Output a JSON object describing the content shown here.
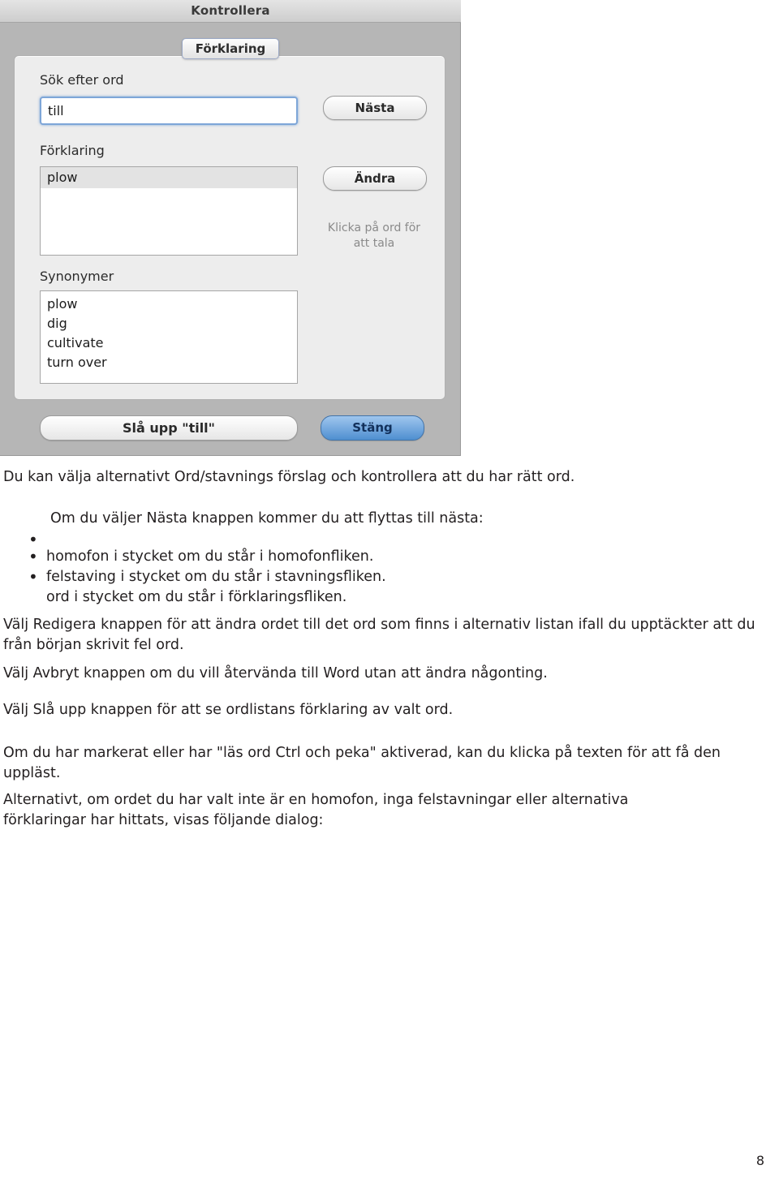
{
  "dialog": {
    "window_title": "Kontrollera",
    "tab_label": "Förklaring",
    "search_label": "Sök efter ord",
    "search_value": "till",
    "explanation_label": "Förklaring",
    "explanation_items": [
      "plow"
    ],
    "synonyms_label": "Synonymer",
    "synonyms": [
      "plow",
      "dig",
      "cultivate",
      "turn over"
    ],
    "next_button": "Nästa",
    "change_button": "Ändra",
    "speak_hint_line1": "Klicka på ord för",
    "speak_hint_line2": "att tala",
    "lookup_button": "Slå upp \"till\"",
    "close_button": "Stäng",
    "accent_color": "#4f8fd0"
  },
  "document": {
    "paragraphs": {
      "intro": "Du kan välja alternativt Ord/stavnings förslag och kontrollera att du har rätt ord.",
      "next_intro": "Om du väljer Nästa knappen kommer du att flyttas till nästa:",
      "bullet_1": "homofon i stycket om du står i homofonfliken.",
      "bullet_2": "felstaving i stycket om du står i stavningsfliken.",
      "bullet_3": "ord i stycket om du står i förklaringsfliken.",
      "edit_para": "Välj Redigera knappen för att ändra ordet till det ord som finns i alternativ listan ifall du upptäckter att du från början skrivit fel ord.",
      "cancel_para": "Välj Avbryt knappen om du vill återvända till Word utan att ändra någonting.",
      "lookup_para": "Välj Slå upp knappen för att se ordlistans förklaring av valt ord.",
      "ctrl_para": "Om du har markerat eller har \"läs ord Ctrl och peka\" aktiverad, kan du klicka på texten för att få den uppläst.",
      "final_para": "Alternativt, om ordet du har valt inte är en homofon, inga felstavningar eller alternativa förklaringar har hittats, visas följande dialog:"
    },
    "bullet_glyph": "•",
    "page_number": "8"
  }
}
